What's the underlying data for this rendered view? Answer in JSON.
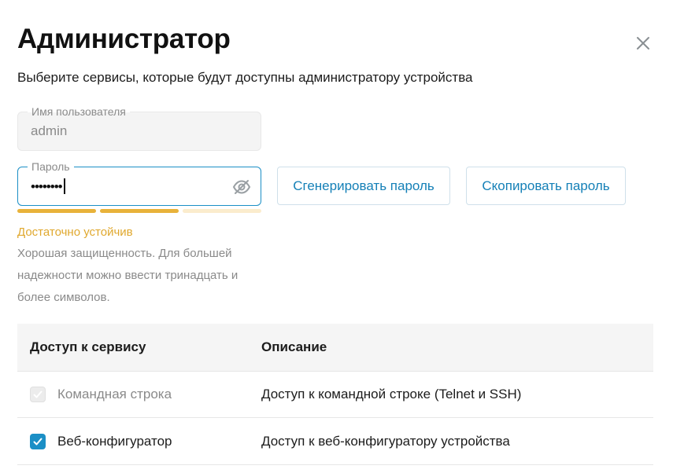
{
  "dialog": {
    "title": "Администратор",
    "subtitle": "Выберите сервисы, которые будут доступны администратору устройства",
    "close_icon": "close-icon"
  },
  "username": {
    "label": "Имя пользователя",
    "value": "admin",
    "disabled": true
  },
  "password": {
    "label": "Пароль",
    "masked_value": "••••••••",
    "visibility_icon": "eye-off-icon",
    "strength": {
      "level": 2,
      "of": 3,
      "label": "Достаточно устойчив",
      "hint": "Хорошая защищенность. Для большей надежности можно ввести тринадцать и более символов.",
      "color_filled": "#e8b23a",
      "color_empty": "#fbeccd",
      "label_color": "#e0a82e"
    }
  },
  "buttons": {
    "generate": "Сгенерировать пароль",
    "copy": "Скопировать пароль"
  },
  "table": {
    "headers": [
      "Доступ к сервису",
      "Описание"
    ],
    "rows": [
      {
        "service": "Командная строка",
        "description": "Доступ к командной строке (Telnet и SSH)",
        "checked": true,
        "disabled": true
      },
      {
        "service": "Веб-конфигуратор",
        "description": "Доступ к веб-конфигуратору устройства",
        "checked": true,
        "disabled": false
      }
    ]
  },
  "colors": {
    "accent": "#1b8fc6",
    "button_text": "#1580b7"
  }
}
